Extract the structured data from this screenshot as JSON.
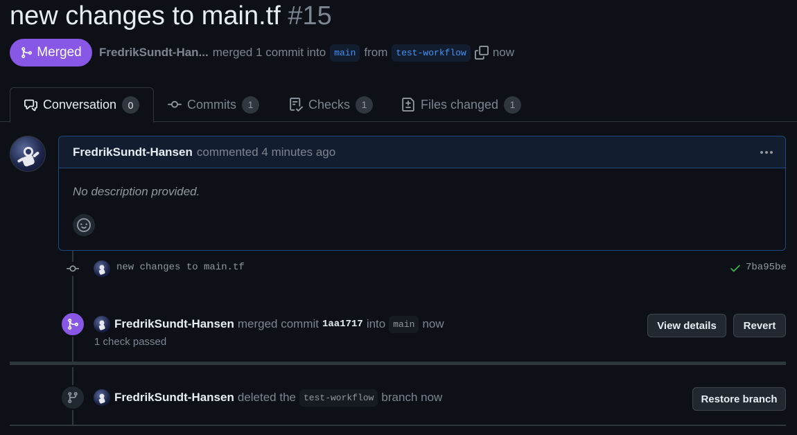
{
  "pr": {
    "title": "new changes to main.tf",
    "number": "#15",
    "state": "Merged",
    "author_short": "FredrikSundt-Han...",
    "merged_text": "merged 1 commit into",
    "base_branch": "main",
    "from_text": "from",
    "head_branch": "test-workflow",
    "time": "now"
  },
  "tabs": [
    {
      "label": "Conversation",
      "count": "0"
    },
    {
      "label": "Commits",
      "count": "1"
    },
    {
      "label": "Checks",
      "count": "1"
    },
    {
      "label": "Files changed",
      "count": "1"
    }
  ],
  "comment": {
    "author": "FredrikSundt-Hansen",
    "action": "commented 4 minutes ago",
    "body": "No description provided."
  },
  "commit": {
    "message": "new changes to main.tf",
    "sha": "7ba95be"
  },
  "merge_event": {
    "author": "FredrikSundt-Hansen",
    "action": "merged commit",
    "sha": "1aa1717",
    "into": "into",
    "branch": "main",
    "time": "now",
    "checks": "1 check passed",
    "view_details": "View details",
    "revert": "Revert"
  },
  "delete_event": {
    "author": "FredrikSundt-Hansen",
    "action": "deleted the",
    "branch": "test-workflow",
    "suffix": "branch now",
    "restore": "Restore branch"
  },
  "colors": {
    "merged": "#8957e5",
    "background": "#0d1117",
    "link": "#4493f8",
    "success": "#3fb950"
  }
}
